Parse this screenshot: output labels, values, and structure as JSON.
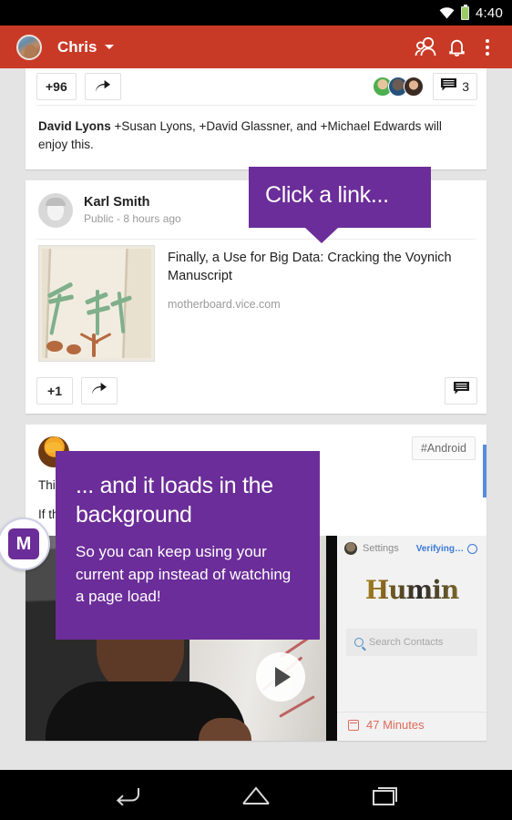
{
  "statusbar": {
    "time": "4:40",
    "wifi_icon": "wifi-icon",
    "battery_icon": "battery-icon"
  },
  "appbar": {
    "account_name": "Chris",
    "avatar": "account-avatar",
    "dropdown_icon": "chevron-down-icon",
    "icons": [
      "people-icon",
      "bell-icon",
      "overflow-menu-icon"
    ]
  },
  "posts": [
    {
      "plusone_label": "+96",
      "share_icon": "share-icon",
      "comment_icon": "comment-icon",
      "comment_count": "3",
      "reshare_author": "David Lyons",
      "reshare_text": " +Susan Lyons, +David Glassner, and +Michael Edwards will enjoy this."
    },
    {
      "author": "Karl Smith",
      "meta": "Public - 8 hours ago",
      "avatar": "author-avatar",
      "link_title": "Finally, a Use for Big Data: Cracking the Voynich Manuscript",
      "link_host": "motherboard.vice.com",
      "link_thumbnail": "voynich-manuscript-thumbnail",
      "plusone_label": "+1",
      "share_icon": "share-icon",
      "comment_icon": "comment-icon"
    },
    {
      "avatar": "author-avatar",
      "tag": "#Android",
      "body_line_1": "Thi                                       t month: Humin.",
      "body_line_2": "If                                       then you must at least wa…",
      "video": {
        "play_icon": "play-button-icon",
        "phone_settings_label": "Settings",
        "phone_verifying_label": "Verifying…",
        "phone_app_name": "Humin",
        "phone_search_placeholder": "Search Contacts",
        "phone_minutes_label": "47 Minutes"
      }
    }
  ],
  "coachmarks": [
    {
      "title": "Click a link..."
    },
    {
      "title": "... and it loads in the background",
      "body": "So you can keep using your current app instead of watching a page load!"
    }
  ],
  "app_badge": {
    "letter": "M"
  },
  "navbar": {
    "back_icon": "back-icon",
    "home_icon": "home-icon",
    "recents-icon": "recents-icon"
  },
  "colors": {
    "appbar": "#c93a26",
    "coachmark": "#6b2d99",
    "accent_blue": "#3b78d8",
    "page_bg": "#e4e4e4"
  }
}
